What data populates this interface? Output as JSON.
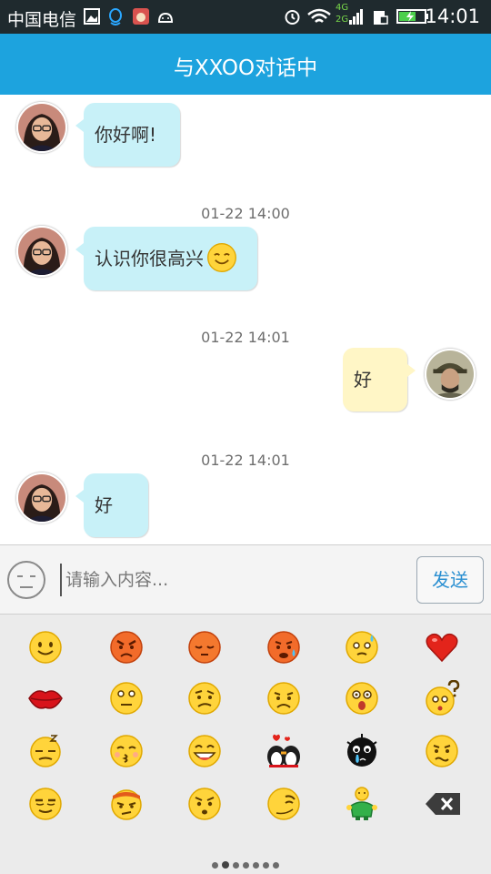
{
  "status_bar": {
    "carrier": "中国电信",
    "network_top": "4G",
    "network_bottom": "2G",
    "time": "14:01"
  },
  "header": {
    "title": "与XXOO对话中"
  },
  "messages": [
    {
      "side": "left",
      "text": "你好啊!"
    },
    {
      "timestamp": "01-22 14:00",
      "side": "left",
      "text": "认识你很高兴",
      "emoji": "smile-emoji"
    },
    {
      "timestamp": "01-22 14:01",
      "side": "right",
      "text": "好"
    },
    {
      "timestamp": "01-22 14:01",
      "side": "left",
      "text": "好"
    }
  ],
  "input": {
    "placeholder": "请输入内容...",
    "send_label": "发送"
  },
  "emoji_grid": [
    [
      "smile",
      "angry",
      "sleepy",
      "crying-sweat",
      "sweat",
      "heart"
    ],
    [
      "lips",
      "surprised",
      "confused",
      "sad",
      "shocked",
      "question"
    ],
    [
      "sleeping",
      "kiss",
      "grin",
      "kissing-penguins",
      "black-crying",
      "shy"
    ],
    [
      "smirk",
      "headband",
      "frown",
      "wink",
      "green-man",
      "backspace"
    ]
  ],
  "pager": {
    "pages": 7,
    "active": 1
  },
  "colors": {
    "status_bar": "#1f2a2e",
    "header": "#1da3de",
    "left_bubble": "#c8f1f8",
    "right_bubble": "#fff6c6",
    "send_text": "#2a8fd1",
    "emoji_panel": "#ebebeb"
  }
}
